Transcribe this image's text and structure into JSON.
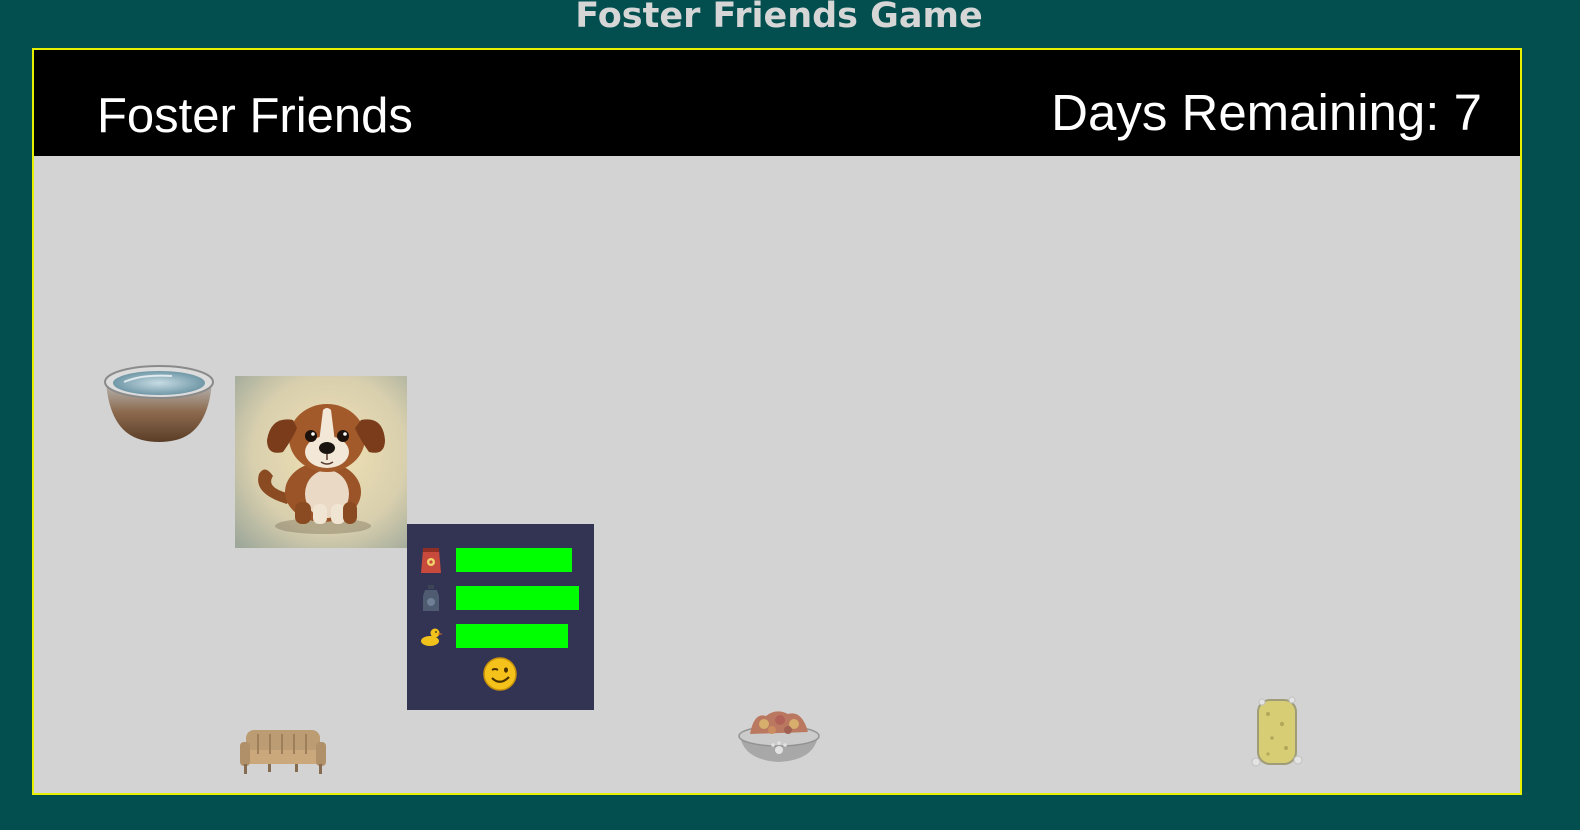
{
  "page": {
    "title": "Foster Friends Game"
  },
  "header": {
    "game_title": "Foster Friends",
    "days_label": "Days Remaining: 7"
  },
  "scene": {
    "water_bowl_icon": "water-bowl-icon",
    "pet": {
      "icon": "puppy-portrait"
    }
  },
  "stats": {
    "hunger": {
      "icon": "food-bag-icon",
      "level": 0.92,
      "color": "#00ff00"
    },
    "thirst": {
      "icon": "water-bottle-icon",
      "level": 0.98,
      "color": "#00ff00"
    },
    "hygiene": {
      "icon": "rubber-duck-icon",
      "level": 0.89,
      "color": "#00ff00"
    },
    "mood": {
      "icon": "winking-face-icon"
    }
  },
  "items": [
    {
      "name": "couch",
      "icon": "couch-icon"
    },
    {
      "name": "food-bowl",
      "icon": "food-bowl-icon"
    },
    {
      "name": "sponge",
      "icon": "sponge-icon"
    }
  ],
  "colors": {
    "background": "#034f50",
    "frame_border": "#e8f000",
    "play_area": "#d3d3d3",
    "panel": "#333354"
  }
}
